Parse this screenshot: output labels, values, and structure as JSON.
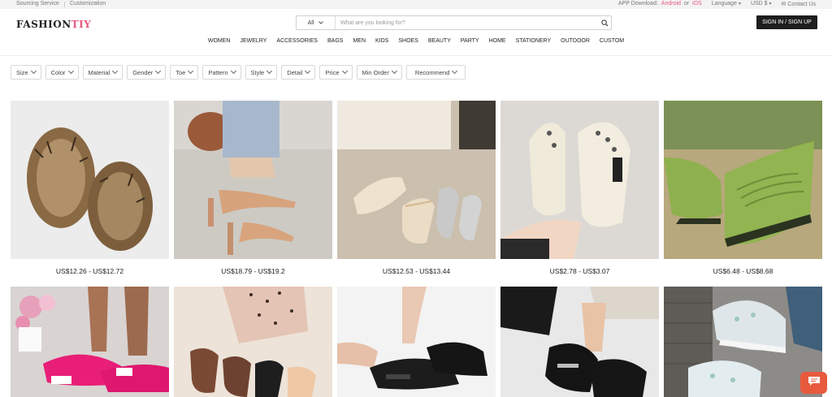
{
  "topbar": {
    "sourcing": "Sourcing Service",
    "customization": "Customization",
    "app_download": "APP Download:",
    "android": "Android",
    "or": "or",
    "ios": "iOS",
    "language": "Language",
    "currency": "USD $",
    "contact": "Contact Us"
  },
  "header": {
    "logo_main": "FASHION",
    "logo_accent": "TIY",
    "search_category": "All",
    "search_placeholder": "What are you looking for?",
    "signin": "SIGN IN / SIGN UP"
  },
  "nav": [
    "WOMEN",
    "JEWELRY",
    "ACCESSORIES",
    "BAGS",
    "MEN",
    "KIDS",
    "SHOES",
    "BEAUTY",
    "PARTY",
    "HOME",
    "STATIONERY",
    "OUTDOOR",
    "CUSTOM"
  ],
  "filters": [
    "Size",
    "Color",
    "Material",
    "Gender",
    "Toe",
    "Pattern",
    "Style",
    "Detail",
    "Price",
    "Min Order",
    "Recommend"
  ],
  "products": [
    {
      "price": "US$12.26 - US$12.72",
      "icon": "fur-slippers-image"
    },
    {
      "price": "US$18.79 - US$19.2",
      "icon": "nude-pump-image"
    },
    {
      "price": "US$12.53 - US$13.44",
      "icon": "mary-jane-flats-image"
    },
    {
      "price": "US$2.78 - US$3.07",
      "icon": "cream-clog-image"
    },
    {
      "price": "US$6.48 - US$8.68",
      "icon": "green-loafer-image"
    },
    {
      "price": "",
      "icon": "pink-flat-image"
    },
    {
      "price": "",
      "icon": "brown-mules-image"
    },
    {
      "price": "",
      "icon": "black-slide-image"
    },
    {
      "price": "",
      "icon": "black-loafer-image"
    },
    {
      "price": "",
      "icon": "mesh-sneaker-image"
    }
  ],
  "colors": {
    "accent_pink": "#e8587f",
    "signin_bg": "#1e1e1e",
    "chat_bg": "#e85a3e"
  }
}
